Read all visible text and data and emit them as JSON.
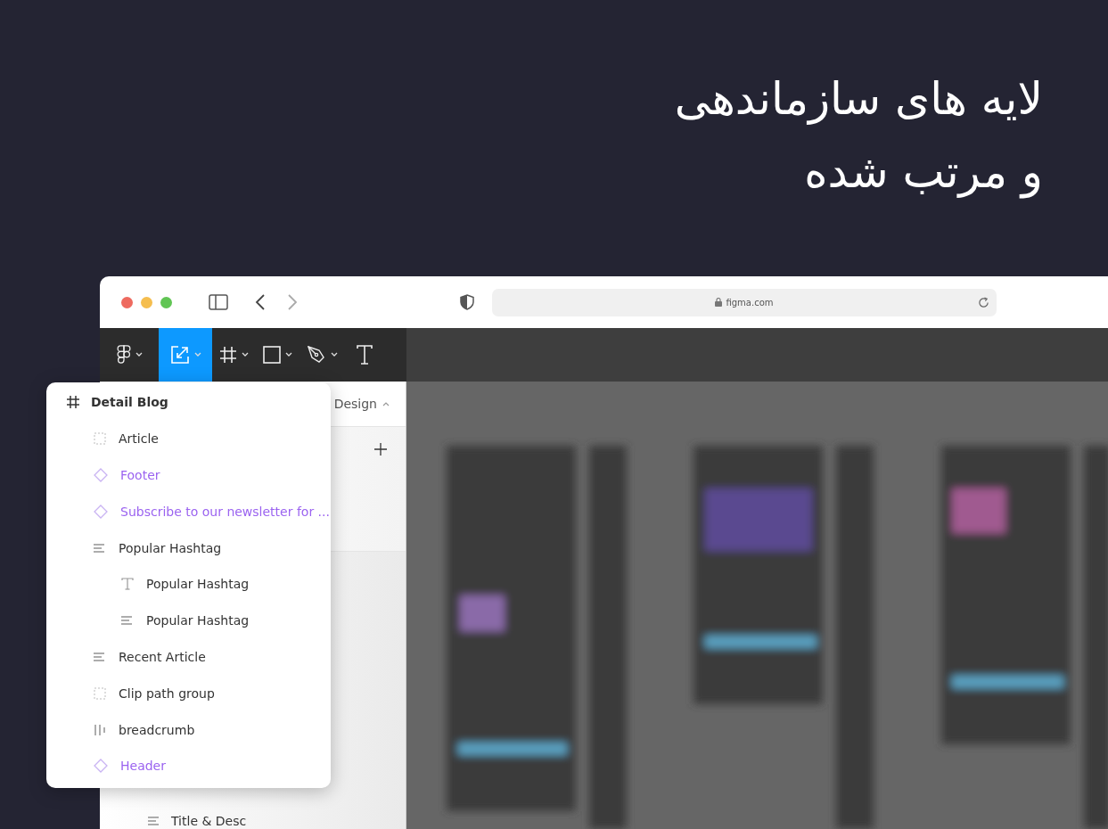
{
  "headline": [
    "لایه های سازماندهی",
    "و مرتب شده"
  ],
  "browser": {
    "url": "figma.com"
  },
  "toolbar": {
    "tools": [
      {
        "kind": "logo",
        "caret": true,
        "selected": false
      },
      {
        "kind": "scale",
        "caret": true,
        "selected": true
      },
      {
        "kind": "frame",
        "caret": true,
        "selected": false
      },
      {
        "kind": "rectangle",
        "caret": true,
        "selected": false
      },
      {
        "kind": "pen",
        "caret": true,
        "selected": false
      },
      {
        "kind": "text",
        "caret": false,
        "selected": false
      }
    ]
  },
  "panel": {
    "tab_label": "Design",
    "bottom_row": "Title & Desc"
  },
  "layers_popup": {
    "title": "Detail Blog",
    "children": [
      {
        "kind": "group",
        "name": "Article"
      },
      {
        "kind": "component",
        "name": "Footer"
      },
      {
        "kind": "component",
        "name": "Subscribe to our newsletter for ..."
      },
      {
        "kind": "autolayout",
        "name": "Popular Hashtag",
        "children": [
          {
            "kind": "text",
            "name": "Popular Hashtag"
          },
          {
            "kind": "autolayout",
            "name": "Popular Hashtag"
          }
        ]
      },
      {
        "kind": "autolayout",
        "name": "Recent Article"
      },
      {
        "kind": "group",
        "name": "Clip path group"
      },
      {
        "kind": "columns",
        "name": "breadcrumb"
      },
      {
        "kind": "component",
        "name": "Header"
      }
    ]
  }
}
